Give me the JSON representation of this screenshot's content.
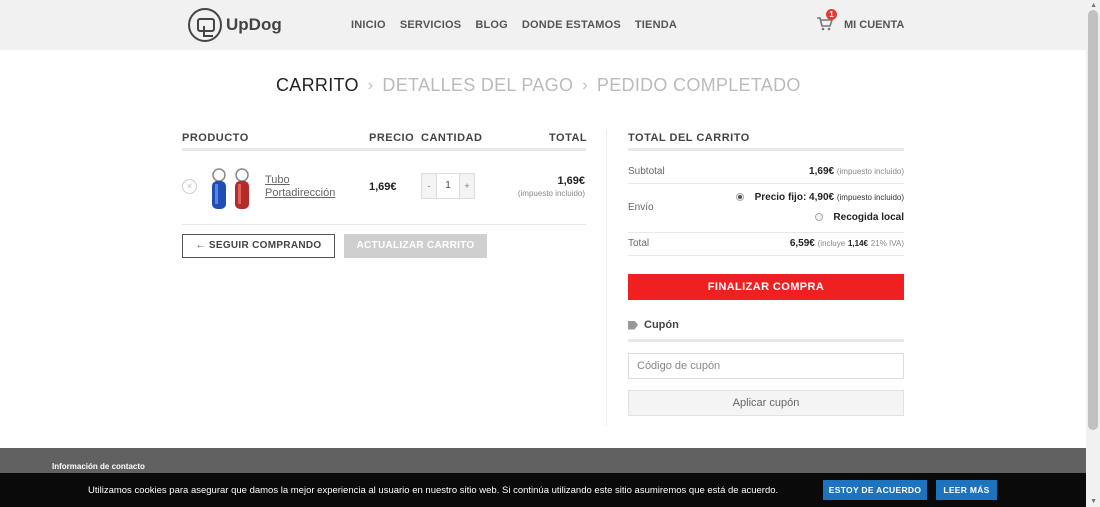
{
  "header": {
    "logo_text": "UpDog",
    "nav": [
      "INICIO",
      "SERVICIOS",
      "BLOG",
      "DONDE ESTAMOS",
      "TIENDA"
    ],
    "cart_count": "1",
    "account_label": "MI CUENTA"
  },
  "steps": {
    "active": "CARRITO",
    "payment": "DETALLES DEL PAGO",
    "complete": "PEDIDO COMPLETADO",
    "separator": "›"
  },
  "cart": {
    "headers": {
      "product": "PRODUCTO",
      "price": "PRECIO",
      "quantity": "CANTIDAD",
      "total": "TOTAL"
    },
    "item": {
      "remove_symbol": "×",
      "name": "Tubo Portadirección",
      "price": "1,69€",
      "qty_minus": "-",
      "qty_value": "1",
      "qty_plus": "+",
      "total": "1,69€",
      "tax_note": "(impuesto incluido)"
    },
    "continue_label": "← SEGUIR COMPRANDO",
    "update_label": "ACTUALIZAR CARRITO"
  },
  "totals": {
    "title": "TOTAL DEL CARRITO",
    "subtotal_label": "Subtotal",
    "subtotal_value": "1,69€",
    "subtotal_note": "(impuesto incluido)",
    "shipping_label": "Envío",
    "shipping_option_1": "Precio fijo: 4,90€",
    "shipping_option_1_note": "(impuesto incluido)",
    "shipping_option_2": "Recogida local",
    "total_label": "Total",
    "total_value": "6,59€",
    "total_note_prefix": "(incluye",
    "total_tax_value": "1,14€",
    "total_note_suffix": "21% IVA)",
    "checkout_label": "FINALIZAR COMPRA"
  },
  "coupon": {
    "title": "Cupón",
    "placeholder": "Código de cupón",
    "apply_label": "Aplicar cupón"
  },
  "footer": {
    "title": "Información de contacto"
  },
  "cookie": {
    "text": "Utilizamos cookies para asegurar que damos la mejor experiencia al usuario en nuestro sitio web. Si continúa utilizando este sitio asumiremos que está de acuerdo.",
    "agree_label": "ESTOY DE ACUERDO",
    "more_label": "LEER MÁS"
  },
  "colors": {
    "checkout_red": "#f02020",
    "cookie_button_blue": "#1e73be",
    "footer_gray": "#616161"
  }
}
